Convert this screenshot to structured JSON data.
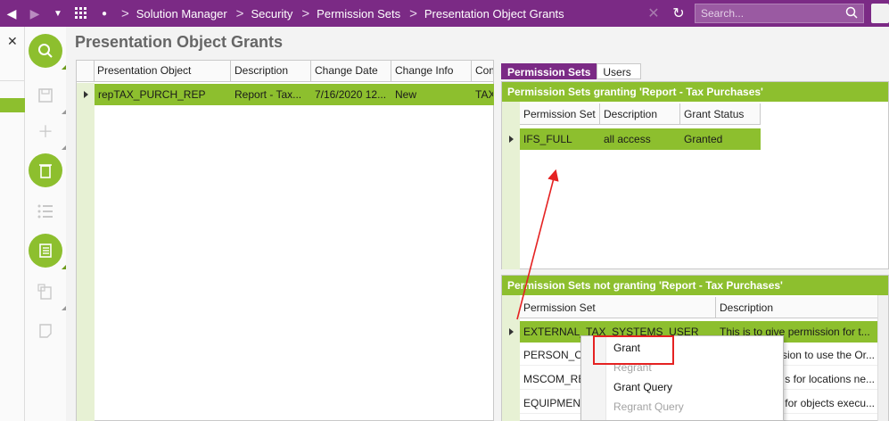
{
  "topbar": {
    "breadcrumbs": [
      "Solution Manager",
      "Security",
      "Permission Sets",
      "Presentation Object Grants"
    ],
    "search_placeholder": "Search..."
  },
  "page": {
    "title": "Presentation Object Grants"
  },
  "left_grid": {
    "columns": [
      "Presentation Object",
      "Description",
      "Change Date",
      "Change Info",
      "Com"
    ],
    "rows": [
      {
        "presentation_object": "repTAX_PURCH_REP",
        "description": "Report - Tax...",
        "change_date": "7/16/2020 12...",
        "change_info": "New",
        "com": "TAX"
      }
    ]
  },
  "tabs": [
    "Permission Sets",
    "Users"
  ],
  "granting": {
    "title": "Permission Sets granting 'Report - Tax Purchases'",
    "columns": [
      "Permission Set",
      "Description",
      "Grant Status"
    ],
    "rows": [
      {
        "permission_set": "IFS_FULL",
        "description": "all access",
        "grant_status": "Granted"
      }
    ]
  },
  "not_granting": {
    "title": "Permission Sets not granting 'Report - Tax Purchases'",
    "columns": [
      "Permission Set",
      "Description"
    ],
    "rows": [
      {
        "permission_set": "EXTERNAL_TAX_SYSTEMS_USER",
        "description": "This is to give permission for t..."
      },
      {
        "permission_set": "PERSON_OR",
        "description": "ssion to use the Or..."
      },
      {
        "permission_set": "MSCOM_RET",
        "description": "s for locations ne..."
      },
      {
        "permission_set": "EQUIPMENT_",
        "description": "s for objects execu..."
      }
    ]
  },
  "context_menu": {
    "items": [
      {
        "label": "Grant",
        "enabled": true
      },
      {
        "label": "Regrant",
        "enabled": false
      },
      {
        "label": "Grant Query",
        "enabled": true
      },
      {
        "label": "Regrant Query",
        "enabled": false
      }
    ]
  },
  "colors": {
    "brand": "#7b2a85",
    "accent": "#8dbf2e",
    "annotation": "#e52222"
  }
}
